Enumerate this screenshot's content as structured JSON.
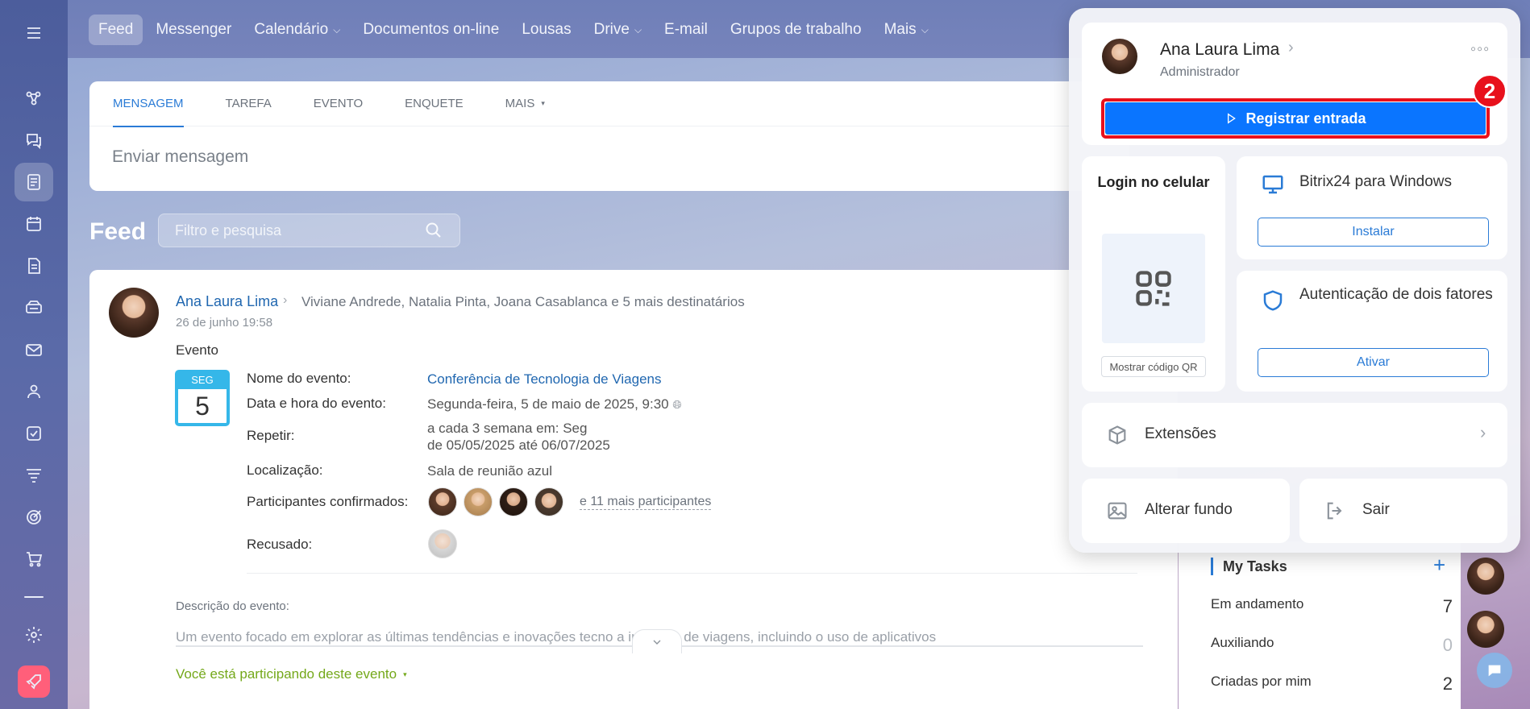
{
  "nav": {
    "items": [
      {
        "label": "Feed",
        "active": true,
        "dropdown": false
      },
      {
        "label": "Messenger",
        "active": false,
        "dropdown": false
      },
      {
        "label": "Calendário",
        "active": false,
        "dropdown": true
      },
      {
        "label": "Documentos on-line",
        "active": false,
        "dropdown": false
      },
      {
        "label": "Lousas",
        "active": false,
        "dropdown": false
      },
      {
        "label": "Drive",
        "active": false,
        "dropdown": true
      },
      {
        "label": "E-mail",
        "active": false,
        "dropdown": false
      },
      {
        "label": "Grupos de trabalho",
        "active": false,
        "dropdown": false
      },
      {
        "label": "Mais",
        "active": false,
        "dropdown": true
      }
    ]
  },
  "composer": {
    "tabs": [
      "MENSAGEM",
      "TAREFA",
      "EVENTO",
      "ENQUETE",
      "MAIS"
    ],
    "placeholder": "Enviar mensagem"
  },
  "feed": {
    "title": "Feed",
    "filter_placeholder": "Filtro e pesquisa"
  },
  "post": {
    "author": "Ana Laura Lima",
    "recipients": "Viviane Andrede, Natalia Pinta, Joana Casablanca  e 5 mais destinatários",
    "date": "26 de junho 19:58",
    "type_label": "Evento",
    "calendar": {
      "dow": "SEG",
      "day": "5"
    },
    "fields": {
      "name_label": "Nome do evento:",
      "name_value": "Conferência de Tecnologia de Viagens",
      "datetime_label": "Data e hora do evento:",
      "datetime_value": "Segunda-feira, 5 de maio de 2025, 9:30",
      "repeat_label": "Repetir:",
      "repeat_line1": "a cada 3 semana em: Seg",
      "repeat_line2": "de 05/05/2025 até 06/07/2025",
      "location_label": "Localização:",
      "location_value": "Sala de reunião azul",
      "confirmed_label": "Participantes confirmados:",
      "confirmed_more": "e 11 mais participantes",
      "refused_label": "Recusado:"
    },
    "description_label": "Descrição do evento:",
    "description_text": "Um evento focado em explorar as últimas tendências e inovações tecno          a indústria de viagens, incluindo o uso de aplicativos",
    "participating": "Você está participando deste evento"
  },
  "tasks": {
    "title": "My Tasks",
    "rows": [
      {
        "label": "Em andamento",
        "count": "7"
      },
      {
        "label": "Auxiliando",
        "count": "0"
      },
      {
        "label": "Criadas por mim",
        "count": "2"
      }
    ]
  },
  "profile": {
    "name": "Ana Laura Lima",
    "role": "Administrador",
    "checkin_button": "Registrar entrada",
    "step_badge": "2",
    "mobile_login": "Login no celular",
    "show_qr": "Mostrar código QR",
    "windows_app": "Bitrix24 para Windows",
    "install_button": "Instalar",
    "two_factor": "Autenticação de dois fatores",
    "activate_button": "Ativar",
    "extensions": "Extensões",
    "change_background": "Alterar fundo",
    "logout": "Sair"
  },
  "colors": {
    "accent": "#2a7bd6",
    "primary_button": "#0a75ff",
    "highlight": "#e8111c",
    "calendar": "#35b7e9",
    "participating": "#74a81a"
  }
}
